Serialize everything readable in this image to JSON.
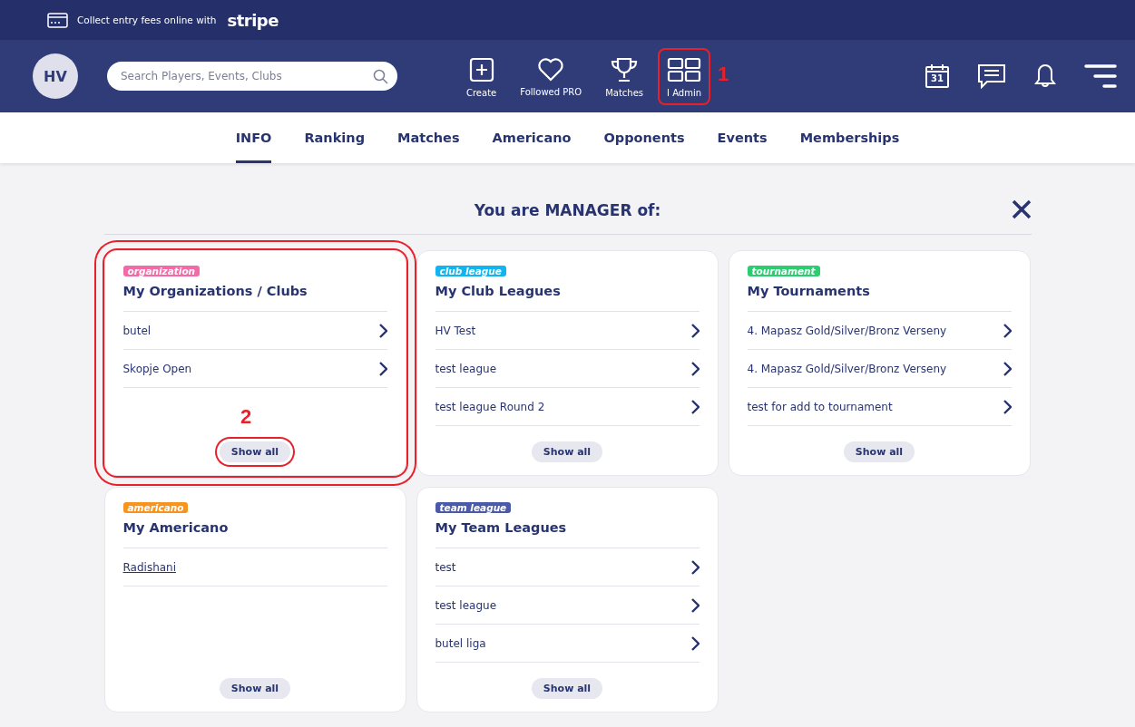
{
  "promo_bar": {
    "text": "Collect entry fees online with",
    "brand": "stripe"
  },
  "header": {
    "avatar": "HV",
    "search": {
      "placeholder": "Search Players, Events, Clubs"
    },
    "nav": [
      {
        "kind": "create",
        "label": "Create"
      },
      {
        "kind": "heart",
        "label": "Followed PRO"
      },
      {
        "kind": "trophy",
        "label": "Matches"
      },
      {
        "kind": "grid",
        "label": "I Admin",
        "annotation": "1"
      }
    ],
    "calendar_day": "31"
  },
  "tabs": [
    {
      "label": "INFO",
      "selected": true
    },
    {
      "label": "Ranking",
      "selected": false
    },
    {
      "label": "Matches",
      "selected": false
    },
    {
      "label": "Americano",
      "selected": false
    },
    {
      "label": "Opponents",
      "selected": false
    },
    {
      "label": "Events",
      "selected": false
    },
    {
      "label": "Memberships",
      "selected": false
    }
  ],
  "section_title": "You are MANAGER of:",
  "cards": [
    {
      "tag": "organization",
      "color": "#f06ba8",
      "title": "My Organizations / Clubs",
      "annotation": "2",
      "button": "Show all",
      "items": [
        {
          "kind": "arrow",
          "label": "butel"
        },
        {
          "kind": "arrow",
          "label": "Skopje Open"
        }
      ]
    },
    {
      "tag": "club league",
      "color": "#12b4ef",
      "title": "My Club Leagues",
      "button": "Show all",
      "items": [
        {
          "kind": "arrow",
          "label": "HV Test"
        },
        {
          "kind": "arrow",
          "label": "test league"
        },
        {
          "kind": "arrow",
          "label": "test league Round 2"
        }
      ]
    },
    {
      "tag": "tournament",
      "color": "#2ecc71",
      "title": "My Tournaments",
      "button": "Show all",
      "items": [
        {
          "kind": "arrow",
          "label": "4. Mapasz Gold/Silver/Bronz Verseny"
        },
        {
          "kind": "arrow",
          "label": "4. Mapasz Gold/Silver/Bronz Verseny"
        },
        {
          "kind": "arrow",
          "label": "test for add to tournament"
        }
      ]
    },
    {
      "tag": "americano",
      "color": "#f7941d",
      "title": "My Americano",
      "button": "Show all",
      "items": [
        {
          "kind": "link",
          "label": "Radishani"
        }
      ]
    },
    {
      "tag": "team league",
      "color": "#4a5aa8",
      "title": "My Team Leagues",
      "button": "Show all",
      "items": [
        {
          "kind": "arrow",
          "label": "test"
        },
        {
          "kind": "arrow",
          "label": "test league"
        },
        {
          "kind": "arrow",
          "label": "butel liga"
        }
      ]
    }
  ]
}
